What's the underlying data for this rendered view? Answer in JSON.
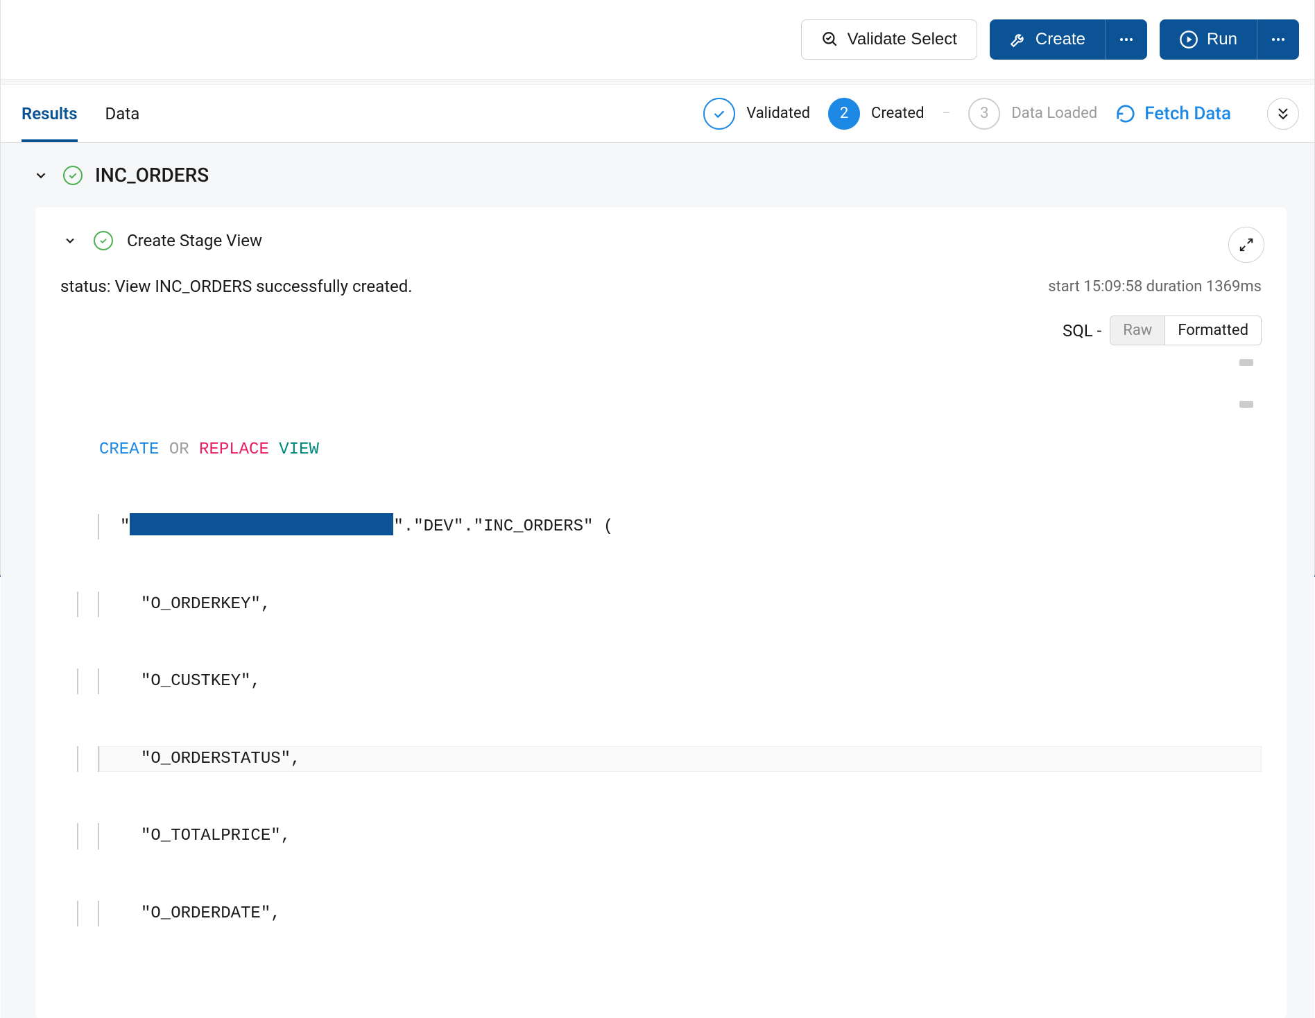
{
  "toolbar": {
    "validate_label": "Validate Select",
    "create_label": "Create",
    "run_label": "Run"
  },
  "tabs": {
    "results": "Results",
    "data": "Data"
  },
  "steps": {
    "validated": {
      "label": "Validated"
    },
    "created": {
      "num": "2",
      "label": "Created"
    },
    "data_loaded": {
      "num": "3",
      "label": "Data Loaded"
    }
  },
  "fetch_data_label": "Fetch Data",
  "section": {
    "title": "INC_ORDERS"
  },
  "panel": {
    "title": "Create Stage View",
    "status_text": "status: View INC_ORDERS successfully created.",
    "meta_text": "start 15:09:58 duration 1369ms",
    "sql_label": "SQL -",
    "toggle_raw": "Raw",
    "toggle_formatted": "Formatted"
  },
  "sql": {
    "kw_create": "CREATE",
    "kw_or": "OR",
    "kw_replace": "REPLACE",
    "kw_view": "VIEW",
    "path_suffix": "\".\"DEV\".\"INC_ORDERS\"",
    "paren_open": "(",
    "cols": [
      "\"O_ORDERKEY\",",
      "\"O_CUSTKEY\",",
      "\"O_ORDERSTATUS\",",
      "\"O_TOTALPRICE\",",
      "\"O_ORDERDATE\","
    ]
  }
}
